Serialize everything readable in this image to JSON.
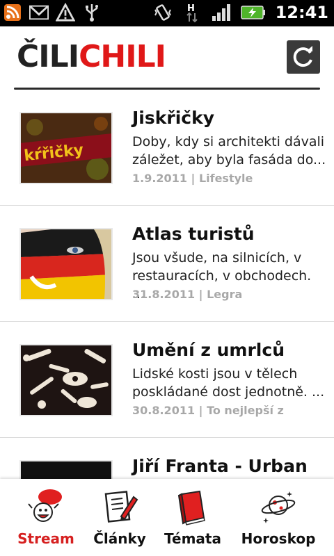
{
  "status_bar": {
    "time": "12:41"
  },
  "header": {
    "logo_part1": "ČILI",
    "logo_part2": "CHILI",
    "accent": "#e01818"
  },
  "articles": [
    {
      "title": "Jiskřičky",
      "excerpt": "Doby, kdy si architekti dávali záležet, aby byla fasáda do...",
      "date": "1.9.2011",
      "category": "Lifestyle",
      "thumb_text": "kŕřičky"
    },
    {
      "title": "Atlas turistů",
      "excerpt": "Jsou všude, na silnicích, v restauracích, v obchodech. ...",
      "date": "31.8.2011",
      "category": "Legra"
    },
    {
      "title": "Umění z umrlců",
      "excerpt": "Lidské kosti jsou v tělech poskládané dost jednotně. ...",
      "date": "30.8.2011",
      "category": "To nejlepší z"
    },
    {
      "title": "Jiří Franta - Urban",
      "excerpt": "",
      "date": "",
      "category": ""
    }
  ],
  "meta_separator": " | ",
  "tabs": [
    {
      "label": "Stream",
      "icon": "stream-icon",
      "active": true
    },
    {
      "label": "Články",
      "icon": "articles-icon",
      "active": false
    },
    {
      "label": "Témata",
      "icon": "topics-book-icon",
      "active": false
    },
    {
      "label": "Horoskop",
      "icon": "horoscope-planet-icon",
      "active": false
    }
  ]
}
